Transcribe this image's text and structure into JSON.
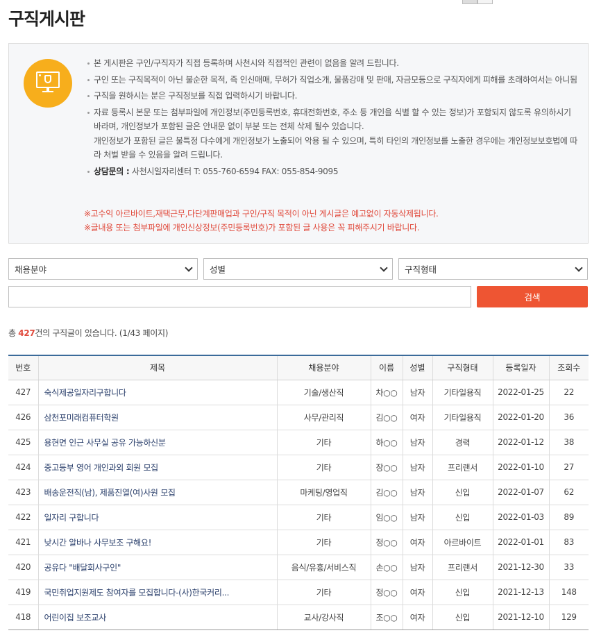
{
  "page": {
    "title": "구직게시판"
  },
  "notice": {
    "items": [
      "본 게시판은 구인/구직자가 직접 등록하며 사천시와 직접적인 관련이 없음을 알려 드립니다.",
      "구인 또는 구직목적이 아닌 불순한 목적, 즉 인신매매, 무허가 직업소개, 물품강매 및 판매, 자금모등으로 구직자에게 피해를 초래하여서는 아니됨",
      "구직을 원하시는 분은 구직정보를 직접 입력하시기 바랍니다.",
      "자료 등록시 본문 또는 첨부파일에 개인정보(주민등록번호, 휴대전화번호, 주소 등 개인을 식별 할 수 있는 정보)가 포함되지 않도록 유의하시기 바라며, 개인정보가 포함된 글은 안내문 없이 부분 또는 전체 삭제 될수 있습니다."
    ],
    "extra": "개인정보가 포함된 글은 불특정 다수에게 개인정보가 노출되어 악용 될 수 있으며, 특히 타인의 개인정보를 노출한 경우에는 개인정보보호법에 따라 처벌 받을 수 있음을 알려 드립니다.",
    "contact_label": "상담문의 :",
    "contact_value": " 사천시일자리센터 T: 055-760-6594 FAX: 055-854-9095",
    "warn1": "※고수익 아르바이트,재택근무,다단계판매업과 구인/구직 목적이 아닌 게시글은 예고없이 자동삭제됩니다.",
    "warn2": "※글내용 또는 첨부파일에 개인신상정보(주민등록번호)가 포함된 글 사용은 꼭 피해주시기 바랍니다."
  },
  "search": {
    "field_select": "채용분야",
    "gender_select": "성별",
    "type_select": "구직형태",
    "input_value": "",
    "button_label": "검색"
  },
  "count": {
    "prefix": "총 ",
    "total": "427",
    "suffix": "건의 구직글이 있습니다. (1/43 페이지)"
  },
  "table": {
    "headers": [
      "번호",
      "제목",
      "채용분야",
      "이름",
      "성별",
      "구직형태",
      "등록일자",
      "조회수"
    ],
    "rows": [
      [
        "427",
        "숙식제공일자리구합니다",
        "기술/생산직",
        "차○○",
        "남자",
        "기타일용직",
        "2022-01-25",
        "22"
      ],
      [
        "426",
        "삼천포미래컴퓨터학원",
        "사무/관리직",
        "김○○",
        "여자",
        "기타일용직",
        "2022-01-20",
        "36"
      ],
      [
        "425",
        "용현면 인근 사무실 공유 가능하신분",
        "기타",
        "하○○",
        "남자",
        "경력",
        "2022-01-12",
        "38"
      ],
      [
        "424",
        "중고등부 영어 개인과외 회원 모집",
        "기타",
        "장○○",
        "남자",
        "프리랜서",
        "2022-01-10",
        "27"
      ],
      [
        "423",
        "배송운전직(남), 제품진열(여)사원 모집",
        "마케팅/영업직",
        "김○○",
        "남자",
        "신입",
        "2022-01-07",
        "62"
      ],
      [
        "422",
        "일자리 구합니다",
        "기타",
        "임○○",
        "남자",
        "신입",
        "2022-01-03",
        "89"
      ],
      [
        "421",
        "낮시간 알바나 사무보조 구해요!",
        "기타",
        "정○○",
        "여자",
        "아르바이트",
        "2022-01-01",
        "83"
      ],
      [
        "420",
        "공유다 \"배달회사구인\"",
        "음식/유흥/서비스직",
        "손○○",
        "남자",
        "프리랜서",
        "2021-12-30",
        "33"
      ],
      [
        "419",
        "국민취업지원제도 참여자를 모집합니다-(사)한국커리...",
        "기타",
        "정○○",
        "여자",
        "신입",
        "2021-12-13",
        "148"
      ],
      [
        "418",
        "어린이집 보조교사",
        "교사/강사직",
        "조○○",
        "여자",
        "신입",
        "2021-12-10",
        "129"
      ]
    ]
  },
  "colors": {
    "accent": "#ee5533",
    "icon_bg": "#f7ae1c",
    "warn_text": "#e04a3c",
    "table_top_border": "#3b6b9a"
  },
  "icons": {
    "notice": "monitor-shield-icon",
    "select": "chevron-down-icon"
  }
}
